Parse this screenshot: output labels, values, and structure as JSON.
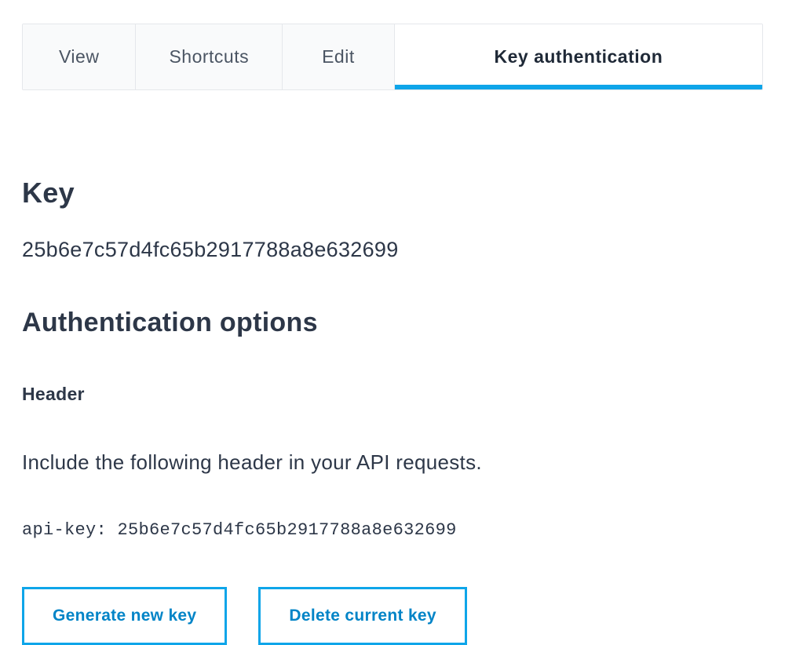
{
  "tabs": {
    "view": "View",
    "shortcuts": "Shortcuts",
    "edit": "Edit",
    "key_auth": "Key authentication"
  },
  "key_section": {
    "heading": "Key",
    "value": "25b6e7c57d4fc65b2917788a8e632699"
  },
  "auth_options": {
    "heading": "Authentication options",
    "header_label": "Header",
    "instruction": "Include the following header in your API requests.",
    "code": "api-key: 25b6e7c57d4fc65b2917788a8e632699"
  },
  "buttons": {
    "generate": "Generate new key",
    "delete": "Delete current key"
  }
}
